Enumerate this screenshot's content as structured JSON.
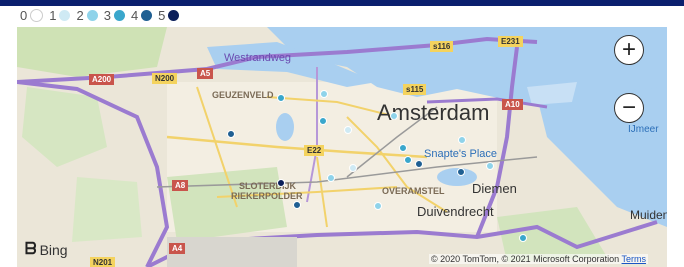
{
  "legend": [
    {
      "label": "0",
      "color": "#ffffff"
    },
    {
      "label": "1",
      "color": "#cfeaf4"
    },
    {
      "label": "2",
      "color": "#8fd3ea"
    },
    {
      "label": "3",
      "color": "#3aa7cc"
    },
    {
      "label": "4",
      "color": "#1f5f92"
    },
    {
      "label": "5",
      "color": "#0b1f5a"
    }
  ],
  "map": {
    "city_label": "Amsterdam",
    "districts": [
      "GEUZENVELD",
      "SLOTERDIJK",
      "RIEKERPOLDER",
      "OVERAMSTEL",
      "Diemen",
      "Duivendrecht",
      "Muiden",
      "IJmeer",
      "Snapte's Place",
      "Westrandweg"
    ],
    "road_shields": [
      "A200",
      "N200",
      "A5",
      "A10",
      "A8",
      "A4",
      "N201",
      "E22",
      "s116",
      "E231",
      "s115",
      "A5"
    ],
    "markers": [
      {
        "level": 3
      },
      {
        "level": 2
      },
      {
        "level": 3
      },
      {
        "level": 4
      },
      {
        "level": 1
      },
      {
        "level": 2
      },
      {
        "level": 3
      },
      {
        "level": 3
      },
      {
        "level": 2
      },
      {
        "level": 4
      },
      {
        "level": 2
      },
      {
        "level": 5
      },
      {
        "level": 4
      },
      {
        "level": 2
      },
      {
        "level": 1
      },
      {
        "level": 3
      },
      {
        "level": 2
      },
      {
        "level": 4
      }
    ],
    "zoom_in": "+",
    "zoom_out": "−",
    "bing_label": "Bing",
    "attribution": "© 2020 TomTom, © 2021 Microsoft Corporation",
    "terms_label": "Terms"
  }
}
